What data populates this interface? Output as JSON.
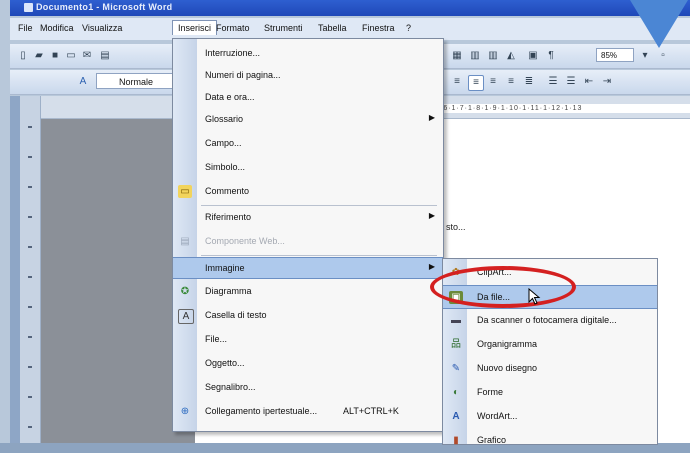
{
  "window": {
    "title": "Documento1 - Microsoft Word"
  },
  "menubar": {
    "items": [
      "File",
      "Modifica",
      "Visualizza",
      "Inserisci",
      "Formato",
      "Strumenti",
      "Tabella",
      "Finestra",
      "?"
    ]
  },
  "toolbar": {
    "style_value": "Normale",
    "zoom_value": "85%"
  },
  "ruler": {
    "marks": "·6·1·7·1·8·1·9·1·10·1·11·1·12·1·13"
  },
  "document": {
    "visible_text": "sto..."
  },
  "insert_menu": {
    "items": [
      {
        "label": "Interruzione...",
        "has_submenu": false,
        "icon": ""
      },
      {
        "label": "Numeri di pagina...",
        "has_submenu": false,
        "icon": ""
      },
      {
        "label": "Data e ora...",
        "has_submenu": false,
        "icon": ""
      },
      {
        "label": "Glossario",
        "has_submenu": true,
        "icon": ""
      },
      {
        "label": "Campo...",
        "has_submenu": false,
        "icon": ""
      },
      {
        "label": "Simbolo...",
        "has_submenu": false,
        "icon": ""
      },
      {
        "label": "Commento",
        "has_submenu": false,
        "icon": "comment-icon"
      },
      {
        "label": "Riferimento",
        "has_submenu": true,
        "icon": ""
      },
      {
        "label": "Componente Web...",
        "has_submenu": false,
        "icon": "web-component-icon",
        "disabled": true
      },
      {
        "label": "Immagine",
        "has_submenu": true,
        "icon": "",
        "highlighted": true
      },
      {
        "label": "Diagramma",
        "has_submenu": false,
        "icon": "diagram-icon"
      },
      {
        "label": "Casella di testo",
        "has_submenu": false,
        "icon": "textbox-icon"
      },
      {
        "label": "File...",
        "has_submenu": false,
        "icon": ""
      },
      {
        "label": "Oggetto...",
        "has_submenu": false,
        "icon": ""
      },
      {
        "label": "Segnalibro...",
        "has_submenu": false,
        "icon": ""
      },
      {
        "label": "Collegamento ipertestuale...",
        "shortcut": "ALT+CTRL+K",
        "has_submenu": false,
        "icon": "hyperlink-icon"
      }
    ]
  },
  "image_submenu": {
    "items": [
      {
        "label": "ClipArt...",
        "icon": "clipart-icon"
      },
      {
        "label": "Da file...",
        "icon": "from-file-icon",
        "highlighted": true
      },
      {
        "label": "Da scanner o fotocamera digitale...",
        "icon": "scanner-icon"
      },
      {
        "label": "Organigramma",
        "icon": "org-chart-icon"
      },
      {
        "label": "Nuovo disegno",
        "icon": "new-drawing-icon"
      },
      {
        "label": "Forme",
        "icon": "shapes-icon"
      },
      {
        "label": "WordArt...",
        "icon": "wordart-icon"
      },
      {
        "label": "Grafico",
        "icon": "chart-icon"
      }
    ]
  },
  "colors": {
    "menu_highlight": "#aec9ec",
    "annotation_red": "#d42020",
    "annotation_arrow": "#4b86d4"
  }
}
